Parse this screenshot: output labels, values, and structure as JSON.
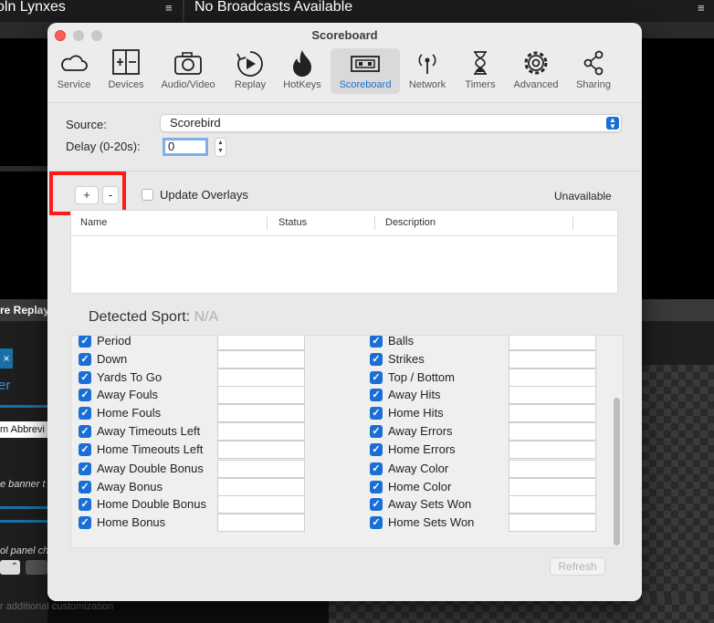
{
  "background": {
    "left_title": "oln Lynxes",
    "right_title": "No Broadcasts Available",
    "menu_glyph": "≡",
    "replay_label": "re Replay",
    "close_glyph": "×",
    "panel_heading": "er",
    "abbrev_field": "m Abbrevi",
    "banner_text": "e banner t",
    "control_text": "ol panel ch",
    "stepper_value": "⌃",
    "bottom_hint": "r additional customization"
  },
  "dialog": {
    "title": "Scoreboard",
    "toolbar": [
      {
        "label": "Service",
        "icon": "cloud-icon"
      },
      {
        "label": "Devices",
        "icon": "devices-icon"
      },
      {
        "label": "Audio/Video",
        "icon": "camera-icon"
      },
      {
        "label": "Replay",
        "icon": "replay-icon"
      },
      {
        "label": "HotKeys",
        "icon": "flame-icon"
      },
      {
        "label": "Scoreboard",
        "icon": "scoreboard-icon",
        "active": true
      },
      {
        "label": "Network",
        "icon": "antenna-icon"
      },
      {
        "label": "Timers",
        "icon": "hourglass-icon"
      },
      {
        "label": "Advanced",
        "icon": "gear-icon"
      },
      {
        "label": "Sharing",
        "icon": "share-icon"
      }
    ],
    "source_label": "Source:",
    "source_value": "Scorebird",
    "delay_label": "Delay (0-20s):",
    "delay_value": "0",
    "add_label": "+",
    "remove_label": "-",
    "update_overlays_label": "Update Overlays",
    "update_overlays_checked": false,
    "status_text": "Unavailable",
    "table_headers": [
      "Name",
      "Status",
      "Description"
    ],
    "detected_label": "Detected Sport:",
    "detected_value": "N/A",
    "left_fields": [
      "Period",
      "Down",
      "Yards To Go",
      "Away Fouls",
      "Home Fouls",
      "Away Timeouts Left",
      "Home Timeouts Left",
      "Away Double Bonus",
      "Away Bonus",
      "Home Double Bonus",
      "Home Bonus"
    ],
    "right_fields": [
      "Balls",
      "Strikes",
      "Top / Bottom",
      "Away Hits",
      "Home Hits",
      "Away Errors",
      "Home Errors",
      "Away Color",
      "Home Color",
      "Away Sets Won",
      "Home Sets Won"
    ],
    "refresh_label": "Refresh",
    "accent_color": "#1a6fd6",
    "highlight_color": "#ff1a1a"
  }
}
